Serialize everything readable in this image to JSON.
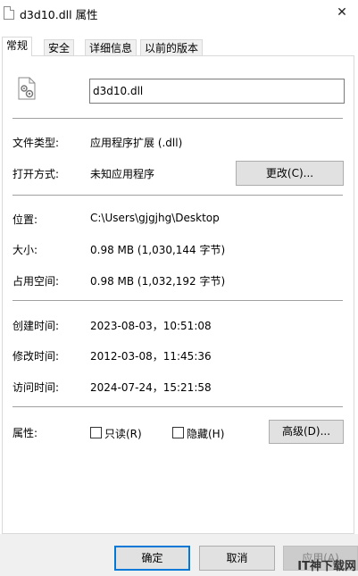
{
  "window": {
    "title": "d3d10.dll 属性",
    "close_glyph": "✕"
  },
  "tabs": [
    {
      "label": "常规",
      "active": true
    },
    {
      "label": "安全",
      "active": false
    },
    {
      "label": "详细信息",
      "active": false
    },
    {
      "label": "以前的版本",
      "active": false
    }
  ],
  "general": {
    "file_name": "d3d10.dll",
    "file_type_label": "文件类型:",
    "file_type_value": "应用程序扩展 (.dll)",
    "opens_with_label": "打开方式:",
    "opens_with_value": "未知应用程序",
    "change_button": "更改(C)...",
    "location_label": "位置:",
    "location_value": "C:\\Users\\gjgjhg\\Desktop",
    "size_label": "大小:",
    "size_value": "0.98 MB (1,030,144 字节)",
    "size_on_disk_label": "占用空间:",
    "size_on_disk_value": "0.98 MB (1,032,192 字节)",
    "created_label": "创建时间:",
    "created_value": "2023-08-03，10:51:08",
    "modified_label": "修改时间:",
    "modified_value": "2012-03-08，11:45:36",
    "accessed_label": "访问时间:",
    "accessed_value": "2024-07-24，15:21:58",
    "attributes_label": "属性:",
    "readonly_label": "只读(R)",
    "readonly_checked": false,
    "hidden_label": "隐藏(H)",
    "hidden_checked": false,
    "advanced_button": "高级(D)..."
  },
  "footer": {
    "ok_button": "确定",
    "cancel_button": "取消",
    "apply_button": "应用(A)",
    "watermark": "IT神下载网"
  }
}
